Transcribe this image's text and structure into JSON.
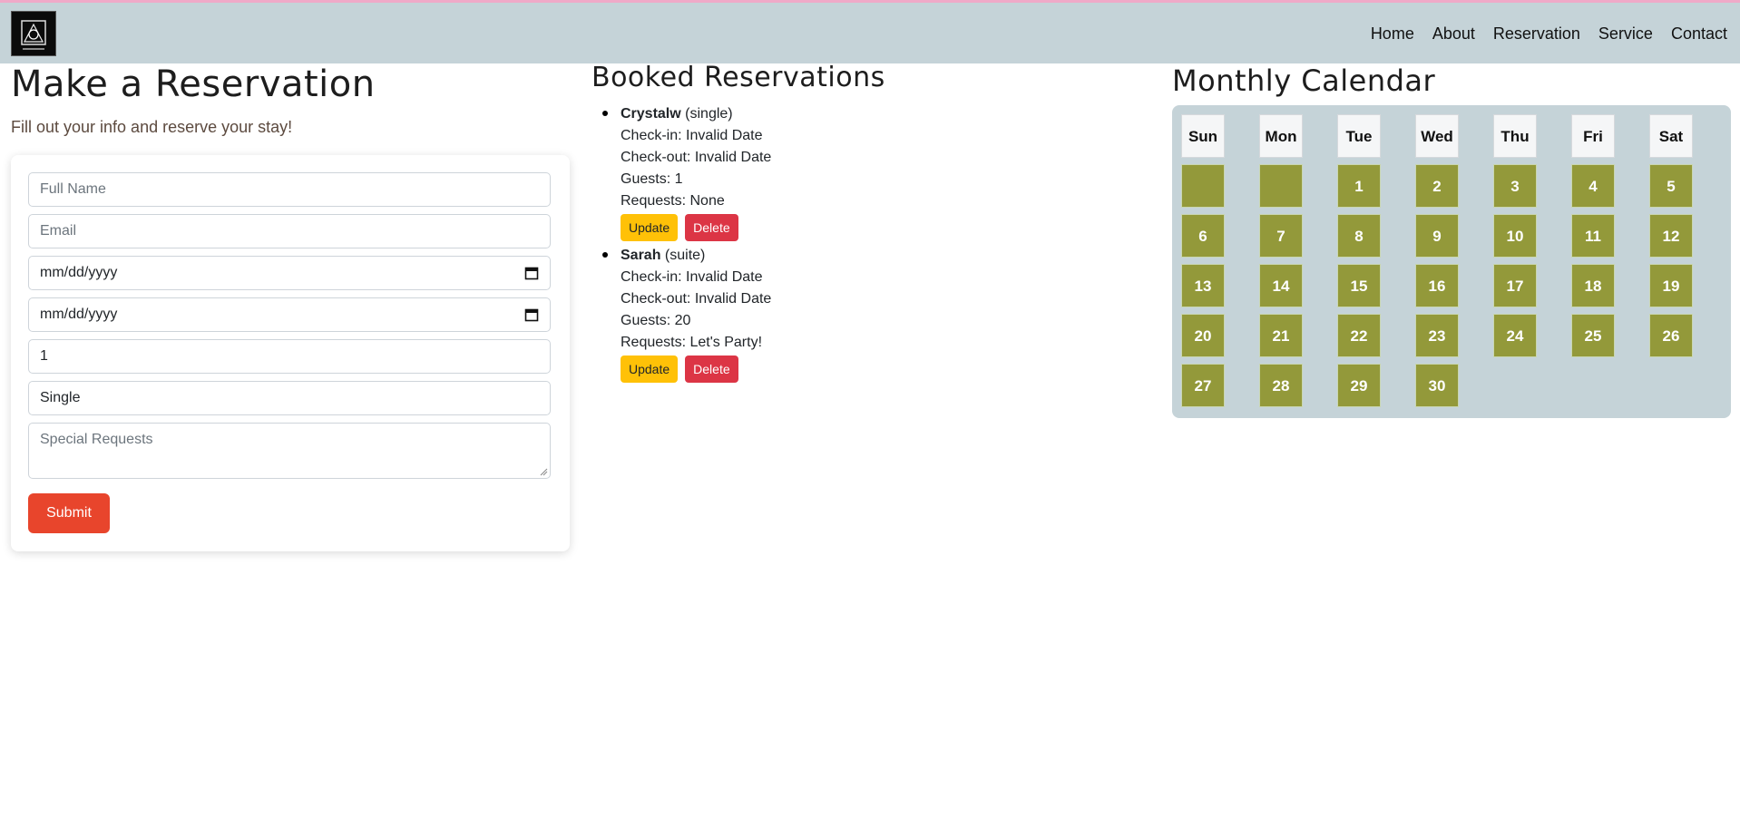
{
  "nav": {
    "items": [
      "Home",
      "About",
      "Reservation",
      "Service",
      "Contact"
    ]
  },
  "form": {
    "title": "Make a Reservation",
    "subtitle": "Fill out your info and reserve your stay!",
    "full_name_placeholder": "Full Name",
    "email_placeholder": "Email",
    "checkin_value": "mm/dd/yyyy",
    "checkout_value": "mm/dd/yyyy",
    "guests_value": "1",
    "room_type_value": "Single",
    "requests_placeholder": "Special Requests",
    "submit_label": "Submit"
  },
  "booked": {
    "title": "Booked Reservations",
    "reservations": [
      {
        "name": "Crystalw",
        "room": "(single)",
        "checkin": "Check-in: Invalid Date",
        "checkout": "Check-out: Invalid Date",
        "guests": "Guests: 1",
        "requests": "Requests: None",
        "update_label": "Update",
        "delete_label": "Delete"
      },
      {
        "name": "Sarah",
        "room": "(suite)",
        "checkin": "Check-in: Invalid Date",
        "checkout": "Check-out: Invalid Date",
        "guests": "Guests: 20",
        "requests": "Requests: Let's Party!",
        "update_label": "Update",
        "delete_label": "Delete"
      }
    ]
  },
  "calendar": {
    "title": "Monthly Calendar",
    "weekdays": [
      "Sun",
      "Mon",
      "Tue",
      "Wed",
      "Thu",
      "Fri",
      "Sat"
    ],
    "leading_blanks": 2,
    "days": [
      "1",
      "2",
      "3",
      "4",
      "5",
      "6",
      "7",
      "8",
      "9",
      "10",
      "11",
      "12",
      "13",
      "14",
      "15",
      "16",
      "17",
      "18",
      "19",
      "20",
      "21",
      "22",
      "23",
      "24",
      "25",
      "26",
      "27",
      "28",
      "29",
      "30"
    ]
  },
  "colors": {
    "topbar": "#c5d3d8",
    "accent_top": "#f0a9c8",
    "submit": "#e8452c",
    "update": "#ffc107",
    "delete": "#dc3545",
    "calendar_day": "#93993a"
  }
}
